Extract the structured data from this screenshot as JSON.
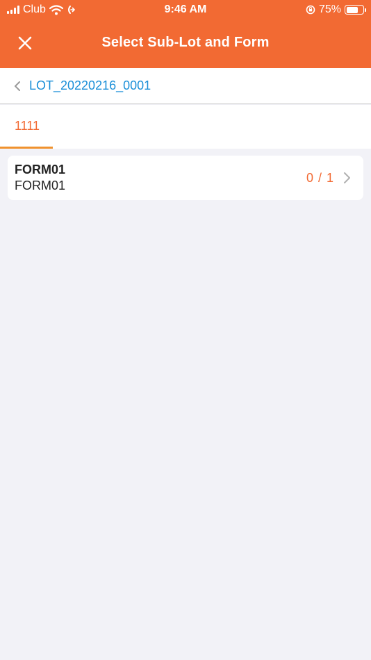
{
  "status_bar": {
    "carrier": "Club",
    "time": "9:46 AM",
    "battery_percent": "75%",
    "battery_level": 0.75,
    "icons": [
      "signal-icon",
      "wifi-icon",
      "call-forward-icon",
      "orientation-lock-icon",
      "battery-icon"
    ]
  },
  "header": {
    "title": "Select Sub-Lot and Form",
    "close_icon": "close-icon",
    "background_color": "#f26a33"
  },
  "breadcrumb": {
    "label": "LOT_20220216_0001",
    "icon": "chevron-left-icon",
    "color": "#1a8fd8"
  },
  "tabs": [
    {
      "label": "1111",
      "active": true
    }
  ],
  "forms": [
    {
      "title": "FORM01",
      "subtitle": "FORM01",
      "count": "0 / 1"
    }
  ],
  "colors": {
    "accent": "#f26a33",
    "tab_underline": "#f0922e",
    "background": "#f2f2f7"
  }
}
